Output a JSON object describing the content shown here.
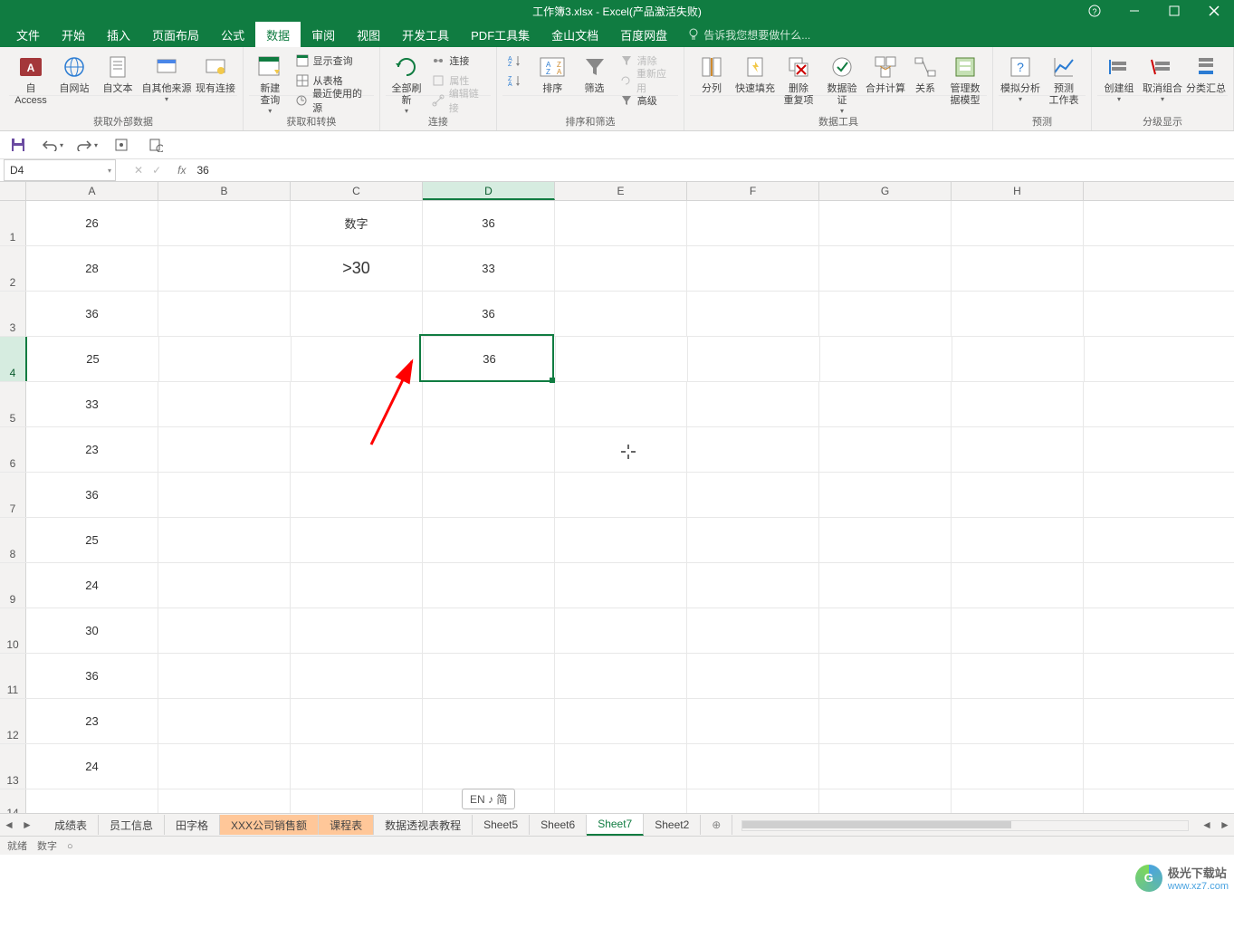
{
  "title": "工作簿3.xlsx - Excel(产品激活失败)",
  "menu": {
    "tabs": [
      "文件",
      "开始",
      "插入",
      "页面布局",
      "公式",
      "数据",
      "审阅",
      "视图",
      "开发工具",
      "PDF工具集",
      "金山文档",
      "百度网盘"
    ],
    "active": 5,
    "tell": "告诉我您想要做什么..."
  },
  "ribbon": {
    "g1": {
      "label": "获取外部数据",
      "btns": [
        "自 Access",
        "自网站",
        "自文本",
        "自其他来源",
        "现有连接"
      ]
    },
    "g2": {
      "label": "获取和转换",
      "big": "新建\n查询",
      "small": [
        "显示查询",
        "从表格",
        "最近使用的源"
      ]
    },
    "g3": {
      "label": "连接",
      "big": "全部刷新",
      "small": [
        "连接",
        "属性",
        "编辑链接"
      ]
    },
    "g4": {
      "label": "排序和筛选",
      "b1": "排序",
      "b2": "筛选",
      "small": [
        "清除",
        "重新应用",
        "高级"
      ],
      "az": "A↓Z",
      "za": "Z↓A"
    },
    "g5": {
      "label": "数据工具",
      "btns": [
        "分列",
        "快速填充",
        "删除\n重复项",
        "数据验\n证",
        "合并计算",
        "关系",
        "管理数\n据模型"
      ]
    },
    "g6": {
      "label": "预测",
      "btns": [
        "模拟分析",
        "预测\n工作表"
      ]
    },
    "g7": {
      "label": "分级显示",
      "btns": [
        "创建组",
        "取消组合",
        "分类汇总"
      ]
    }
  },
  "qat": {
    "save": "save",
    "undo": "undo",
    "redo": "redo"
  },
  "formula": {
    "cellref": "D4",
    "value": "36"
  },
  "columns": [
    "A",
    "B",
    "C",
    "D",
    "E",
    "F",
    "G",
    "H"
  ],
  "selectedCol": 3,
  "selectedRow": 4,
  "chart_data": {
    "type": "table",
    "columns": [
      "A",
      "B",
      "C",
      "D"
    ],
    "rows": [
      {
        "r": 1,
        "A": "26",
        "C": "数字",
        "D": "36"
      },
      {
        "r": 2,
        "A": "28",
        "C": ">30",
        "D": "33"
      },
      {
        "r": 3,
        "A": "36",
        "D": "36"
      },
      {
        "r": 4,
        "A": "25",
        "D": "36"
      },
      {
        "r": 5,
        "A": "33"
      },
      {
        "r": 6,
        "A": "23"
      },
      {
        "r": 7,
        "A": "36"
      },
      {
        "r": 8,
        "A": "25"
      },
      {
        "r": 9,
        "A": "24"
      },
      {
        "r": 10,
        "A": "30"
      },
      {
        "r": 11,
        "A": "36"
      },
      {
        "r": 12,
        "A": "23"
      },
      {
        "r": 13,
        "A": "24"
      }
    ]
  },
  "sheets": {
    "tabs": [
      "成绩表",
      "员工信息",
      "田字格",
      "XXX公司销售额",
      "课程表",
      "数据透视表教程",
      "Sheet5",
      "Sheet6",
      "Sheet7",
      "Sheet2"
    ],
    "active": 8,
    "highlight": [
      3,
      4
    ]
  },
  "status": "就绪　数字　○",
  "ime": "EN ♪ 简",
  "watermark": {
    "name": "极光下载站",
    "url": "www.xz7.com"
  }
}
